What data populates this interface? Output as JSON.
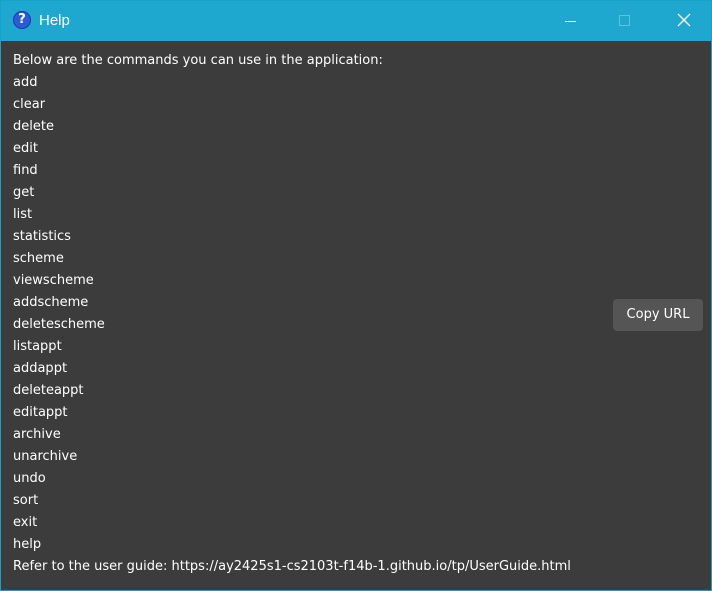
{
  "window": {
    "title": "Help",
    "app_icon_glyph": "?",
    "icons": {
      "app": "help-icon",
      "minimize": "minimize-icon",
      "maximize": "maximize-icon",
      "close": "close-icon"
    },
    "colors": {
      "titlebar": "#1ea7cf",
      "content_background": "#3c3c3c",
      "text": "#ffffff",
      "button": "#555555"
    }
  },
  "help": {
    "intro": "Below are the commands you can use in the application:",
    "commands": [
      "add",
      "clear",
      "delete",
      "edit",
      "find",
      "get",
      "list",
      "statistics",
      "scheme",
      "viewscheme",
      "addscheme",
      "deletescheme",
      "listappt",
      "addappt",
      "deleteappt",
      "editappt",
      "archive",
      "unarchive",
      "undo",
      "sort",
      "exit",
      "help"
    ],
    "user_guide_text": "Refer to the user guide: https://ay2425s1-cs2103t-f14b-1.github.io/tp/UserGuide.html",
    "copy_button_label": "Copy URL"
  }
}
